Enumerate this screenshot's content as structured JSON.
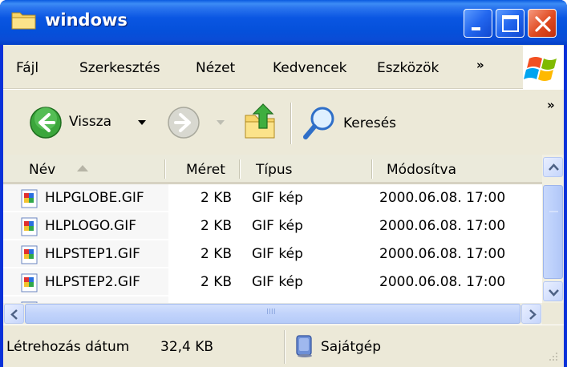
{
  "window": {
    "title": "windows"
  },
  "menu": {
    "items": [
      {
        "label": "Fájl"
      },
      {
        "label": "Szerkesztés"
      },
      {
        "label": "Nézet"
      },
      {
        "label": "Kedvencek"
      },
      {
        "label": "Eszközök"
      }
    ],
    "overflow": "»"
  },
  "toolbar": {
    "back_label": "Vissza",
    "search_label": "Keresés",
    "overflow": "»"
  },
  "columns": [
    "Név",
    "Méret",
    "Típus",
    "Módosítva"
  ],
  "files": [
    {
      "name": "HLPGLOBE.GIF",
      "size": "2 KB",
      "type": "GIF kép",
      "modified": "2000.06.08. 17:00"
    },
    {
      "name": "HLPLOGO.GIF",
      "size": "2 KB",
      "type": "GIF kép",
      "modified": "2000.06.08. 17:00"
    },
    {
      "name": "HLPSTEP1.GIF",
      "size": "2 KB",
      "type": "GIF kép",
      "modified": "2000.06.08. 17:00"
    },
    {
      "name": "HLPSTEP2.GIF",
      "size": "2 KB",
      "type": "GIF kép",
      "modified": "2000.06.08. 17:00"
    }
  ],
  "statusbar": {
    "description": "Létrehozás dátum",
    "size": "32,4 KB",
    "location": "Sajátgép"
  },
  "scrollbar": {
    "h_thumb_grip": "IIII"
  },
  "colors": {
    "titlebar": "#0a56e2",
    "chrome": "#ece9d8",
    "close_button": "#e04a20"
  },
  "icons": [
    "folder-icon",
    "minimize-icon",
    "maximize-icon",
    "close-icon",
    "windows-logo-icon",
    "back-arrow-icon",
    "forward-arrow-icon",
    "folder-up-icon",
    "search-icon",
    "gif-file-icon",
    "my-computer-icon"
  ]
}
